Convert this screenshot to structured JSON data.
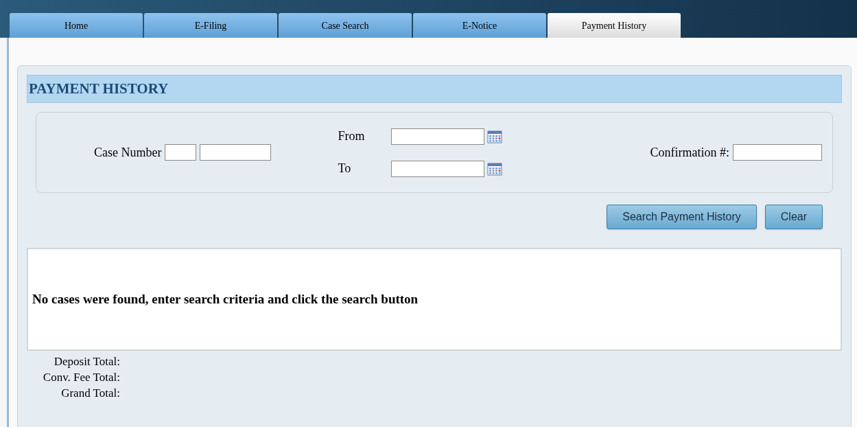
{
  "tabs": [
    {
      "label": "Home",
      "selected": false
    },
    {
      "label": "E-Filing",
      "selected": false
    },
    {
      "label": "Case Search",
      "selected": false
    },
    {
      "label": "E-Notice",
      "selected": false
    },
    {
      "label": "Payment History",
      "selected": true
    }
  ],
  "panel": {
    "title": "PAYMENT HISTORY"
  },
  "search": {
    "case_number_label": "Case Number",
    "from_label": "From",
    "to_label": "To",
    "confirmation_label": "Confirmation #:"
  },
  "buttons": [
    "Search Payment History",
    "Clear"
  ],
  "results": {
    "message": "No cases were found, enter search criteria and click the search button"
  },
  "totals": [
    "Deposit Total:",
    "Conv. Fee Total:",
    "Grand Total:"
  ]
}
